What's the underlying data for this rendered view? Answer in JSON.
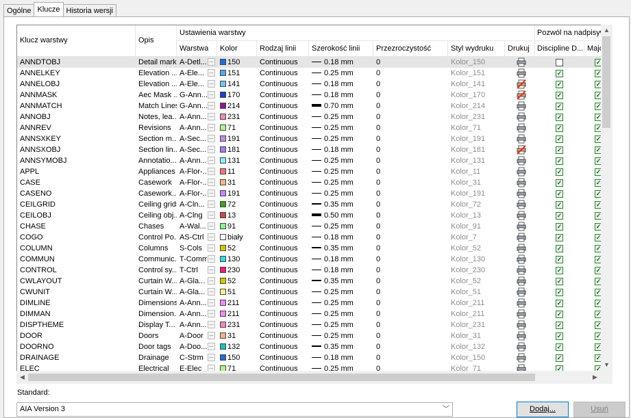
{
  "tabs": [
    "Ogólne",
    "Klucze",
    "Historia wersji"
  ],
  "active_tab": 1,
  "headers": {
    "key": "Klucz warstwy",
    "desc": "Opis",
    "group_settings": "Ustawienia warstwy",
    "layer": "Warstwa",
    "color": "Kolor",
    "linetype": "Rodzaj linii",
    "lineweight": "Szerokość linii",
    "transparency": "Przezroczystość",
    "plotstyle": "Styl wydruku",
    "plot": "Drukuj",
    "group_override": "Pozwól na nadpisywani",
    "discipline": "Discipline D...",
    "major": "Major"
  },
  "rows": [
    {
      "key": "ANNDTOBJ",
      "desc": "Detail marks",
      "layer": "A-Detl...",
      "color": "150",
      "hex": "#1f6fd6",
      "lt": "Continuous",
      "lw": "0.18 mm",
      "tr": "0",
      "ps": "Kolor_150",
      "plot": true,
      "disc": false,
      "major": true
    },
    {
      "key": "ANNELKEY",
      "desc": "Elevation ...",
      "layer": "A-Ele...",
      "color": "151",
      "hex": "#5aa8f0",
      "lt": "Continuous",
      "lw": "0.25 mm",
      "tr": "0",
      "ps": "Kolor_151",
      "plot": true,
      "disc": true,
      "major": true
    },
    {
      "key": "ANNELOBJ",
      "desc": "Elevation ...",
      "layer": "A-Ele...",
      "color": "141",
      "hex": "#6fc8f4",
      "lt": "Continuous",
      "lw": "0.18 mm",
      "tr": "0",
      "ps": "Kolor_141",
      "plot": false,
      "disc": true,
      "major": true
    },
    {
      "key": "ANNMASK",
      "desc": "Aec Mask ...",
      "layer": "G-Ann...",
      "color": "170",
      "hex": "#1c3fd0",
      "lt": "Continuous",
      "lw": "0.18 mm",
      "tr": "0",
      "ps": "Kolor_170",
      "plot": false,
      "disc": true,
      "major": true
    },
    {
      "key": "ANNMATCH",
      "desc": "Match Lines",
      "layer": "G-Ann...",
      "color": "214",
      "hex": "#8e1a8e",
      "lt": "Continuous",
      "lw": "0.70 mm",
      "tr": "0",
      "ps": "Kolor_214",
      "plot": true,
      "disc": true,
      "major": true
    },
    {
      "key": "ANNOBJ",
      "desc": "Notes, lea...",
      "layer": "A-Ann...",
      "color": "231",
      "hex": "#f08cb4",
      "lt": "Continuous",
      "lw": "0.25 mm",
      "tr": "0",
      "ps": "Kolor_231",
      "plot": true,
      "disc": true,
      "major": true
    },
    {
      "key": "ANNREV",
      "desc": "Revisions",
      "layer": "A-Ann...",
      "color": "71",
      "hex": "#b4f08c",
      "lt": "Continuous",
      "lw": "0.25 mm",
      "tr": "0",
      "ps": "Kolor_71",
      "plot": true,
      "disc": true,
      "major": true
    },
    {
      "key": "ANNSXKEY",
      "desc": "Section m...",
      "layer": "A-Sec...",
      "color": "191",
      "hex": "#c08cf0",
      "lt": "Continuous",
      "lw": "0.25 mm",
      "tr": "0",
      "ps": "Kolor_191",
      "plot": true,
      "disc": true,
      "major": true
    },
    {
      "key": "ANNSXOBJ",
      "desc": "Section lin...",
      "layer": "A-Sec...",
      "color": "181",
      "hex": "#a07cf0",
      "lt": "Continuous",
      "lw": "0.18 mm",
      "tr": "0",
      "ps": "Kolor_181",
      "plot": false,
      "disc": true,
      "major": true
    },
    {
      "key": "ANNSYMOBJ",
      "desc": "Annotatio...",
      "layer": "A-Ann...",
      "color": "131",
      "hex": "#8cf0f0",
      "lt": "Continuous",
      "lw": "0.25 mm",
      "tr": "0",
      "ps": "Kolor_131",
      "plot": true,
      "disc": true,
      "major": true
    },
    {
      "key": "APPL",
      "desc": "Appliances",
      "layer": "A-Flor-...",
      "color": "11",
      "hex": "#f07878",
      "lt": "Continuous",
      "lw": "0.25 mm",
      "tr": "0",
      "ps": "Kolor_11",
      "plot": true,
      "disc": true,
      "major": true
    },
    {
      "key": "CASE",
      "desc": "Casework",
      "layer": "A-Flor-...",
      "color": "31",
      "hex": "#f4b48c",
      "lt": "Continuous",
      "lw": "0.25 mm",
      "tr": "0",
      "ps": "Kolor_31",
      "plot": true,
      "disc": true,
      "major": true
    },
    {
      "key": "CASENO",
      "desc": "Casework...",
      "layer": "A-Flor-...",
      "color": "191",
      "hex": "#c08cf0",
      "lt": "Continuous",
      "lw": "0.25 mm",
      "tr": "0",
      "ps": "Kolor_191",
      "plot": true,
      "disc": true,
      "major": true
    },
    {
      "key": "CEILGRID",
      "desc": "Ceiling grids",
      "layer": "A-Cln...",
      "color": "72",
      "hex": "#3ca01e",
      "lt": "Continuous",
      "lw": "0.35 mm",
      "tr": "0",
      "ps": "Kolor_72",
      "plot": true,
      "disc": true,
      "major": true
    },
    {
      "key": "CEILOBJ",
      "desc": "Ceiling obj...",
      "layer": "A-Clng",
      "color": "13",
      "hex": "#c84b4b",
      "lt": "Continuous",
      "lw": "0.50 mm",
      "tr": "0",
      "ps": "Kolor_13",
      "plot": true,
      "disc": true,
      "major": true
    },
    {
      "key": "CHASE",
      "desc": "Chases",
      "layer": "A-Wal...",
      "color": "91",
      "hex": "#8cf08c",
      "lt": "Continuous",
      "lw": "0.25 mm",
      "tr": "0",
      "ps": "Kolor_91",
      "plot": true,
      "disc": true,
      "major": true
    },
    {
      "key": "COGO",
      "desc": "Control Po...",
      "layer": "AS-Ctrl",
      "color": "biały",
      "hex": "#ffffff",
      "lt": "Continuous",
      "lw": "0.18 mm",
      "tr": "0",
      "ps": "Kolor_7",
      "plot": true,
      "disc": true,
      "major": true
    },
    {
      "key": "COLUMN",
      "desc": "Columns",
      "layer": "S-Cols",
      "color": "52",
      "hex": "#d2c800",
      "lt": "Continuous",
      "lw": "0.35 mm",
      "tr": "0",
      "ps": "Kolor_52",
      "plot": true,
      "disc": true,
      "major": true
    },
    {
      "key": "COMMUN",
      "desc": "Communic...",
      "layer": "T-Comm",
      "color": "130",
      "hex": "#3cd2e6",
      "lt": "Continuous",
      "lw": "0.18 mm",
      "tr": "0",
      "ps": "Kolor_130",
      "plot": true,
      "disc": true,
      "major": true
    },
    {
      "key": "CONTROL",
      "desc": "Control sy...",
      "layer": "T-Ctrl",
      "color": "230",
      "hex": "#e61e78",
      "lt": "Continuous",
      "lw": "0.18 mm",
      "tr": "0",
      "ps": "Kolor_230",
      "plot": true,
      "disc": true,
      "major": true
    },
    {
      "key": "CWLAYOUT",
      "desc": "Curtain W...",
      "layer": "A-Gla...",
      "color": "52",
      "hex": "#d2c800",
      "lt": "Continuous",
      "lw": "0.35 mm",
      "tr": "0",
      "ps": "Kolor_52",
      "plot": true,
      "disc": true,
      "major": true
    },
    {
      "key": "CWUNIT",
      "desc": "Curtain W...",
      "layer": "A-Gla...",
      "color": "51",
      "hex": "#f5f08c",
      "lt": "Continuous",
      "lw": "0.25 mm",
      "tr": "0",
      "ps": "Kolor_51",
      "plot": true,
      "disc": true,
      "major": true
    },
    {
      "key": "DIMLINE",
      "desc": "Dimensions",
      "layer": "A-Ann...",
      "color": "211",
      "hex": "#f08cf0",
      "lt": "Continuous",
      "lw": "0.25 mm",
      "tr": "0",
      "ps": "Kolor_211",
      "plot": true,
      "disc": true,
      "major": true
    },
    {
      "key": "DIMMAN",
      "desc": "Dimension...",
      "layer": "A-Ann...",
      "color": "211",
      "hex": "#f08cf0",
      "lt": "Continuous",
      "lw": "0.25 mm",
      "tr": "0",
      "ps": "Kolor_211",
      "plot": true,
      "disc": true,
      "major": true
    },
    {
      "key": "DISPTHEME",
      "desc": "Display T...",
      "layer": "A-Ann...",
      "color": "231",
      "hex": "#f08cb4",
      "lt": "Continuous",
      "lw": "0.25 mm",
      "tr": "0",
      "ps": "Kolor_231",
      "plot": true,
      "disc": true,
      "major": true
    },
    {
      "key": "DOOR",
      "desc": "Doors",
      "layer": "A-Door",
      "color": "31",
      "hex": "#f4b48c",
      "lt": "Continuous",
      "lw": "0.25 mm",
      "tr": "0",
      "ps": "Kolor_31",
      "plot": true,
      "disc": true,
      "major": true
    },
    {
      "key": "DOORNO",
      "desc": "Door tags",
      "layer": "A-Doo...",
      "color": "132",
      "hex": "#1ebeb4",
      "lt": "Continuous",
      "lw": "0.35 mm",
      "tr": "0",
      "ps": "Kolor_132",
      "plot": true,
      "disc": true,
      "major": true
    },
    {
      "key": "DRAINAGE",
      "desc": "Drainage",
      "layer": "C-Strm",
      "color": "150",
      "hex": "#1f6fd6",
      "lt": "Continuous",
      "lw": "0.18 mm",
      "tr": "0",
      "ps": "Kolor_150",
      "plot": true,
      "disc": true,
      "major": true
    },
    {
      "key": "ELEC",
      "desc": "Electrical",
      "layer": "E-Elec",
      "color": "71",
      "hex": "#b4f08c",
      "lt": "Continuous",
      "lw": "0.25 mm",
      "tr": "0",
      "ps": "Kolor_71",
      "plot": true,
      "disc": true,
      "major": true
    }
  ],
  "standard_label": "Standard:",
  "standard_value": "AIA Version 3",
  "buttons": {
    "add": "Dodaj...",
    "remove": "Usuń"
  }
}
